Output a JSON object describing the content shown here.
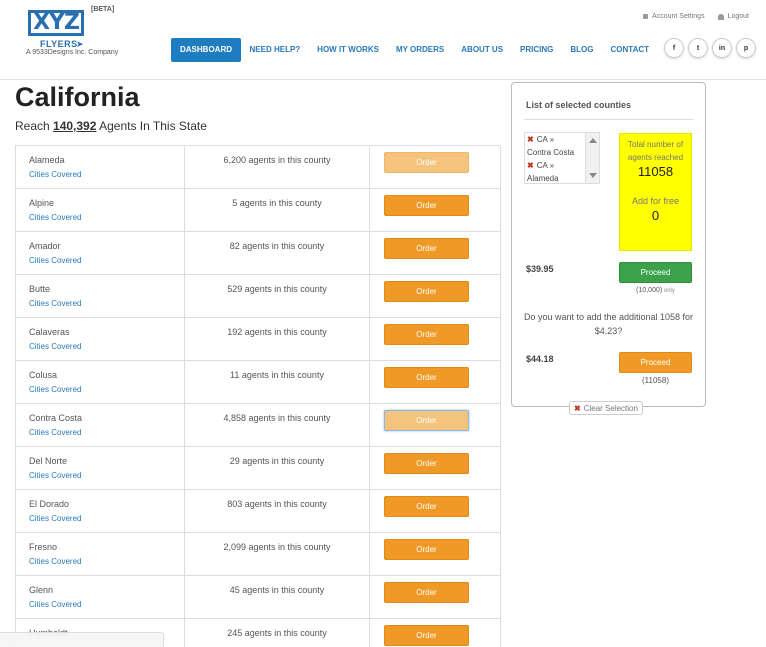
{
  "brand": {
    "logo_text": "XYZ",
    "beta": "[BETA]",
    "flyers": "FLYERS",
    "company": "A 9533Designs Inc. Company",
    "accent": "#2a6fb0"
  },
  "top_links": {
    "account": "Account Settings",
    "logout": "Logout"
  },
  "nav": [
    "DASHBOARD",
    "NEED HELP?",
    "HOW IT WORKS",
    "MY ORDERS",
    "ABOUT US",
    "PRICING",
    "BLOG",
    "CONTACT"
  ],
  "socials": [
    "f",
    "t",
    "in",
    "p"
  ],
  "page": {
    "title": "California",
    "reach_prefix": "Reach ",
    "reach_count": "140,392",
    "reach_suffix": " Agents In This State"
  },
  "counties": [
    {
      "name": "Alameda",
      "cities": "Cities Covered",
      "agents": "6,200 agents in this county",
      "order": "Order",
      "state": "faded"
    },
    {
      "name": "Alpine",
      "cities": "Cities Covered",
      "agents": "5 agents in this county",
      "order": "Order",
      "state": "normal"
    },
    {
      "name": "Amador",
      "cities": "Cities Covered",
      "agents": "82 agents in this county",
      "order": "Order",
      "state": "normal"
    },
    {
      "name": "Butte",
      "cities": "Cities Covered",
      "agents": "529 agents in this county",
      "order": "Order",
      "state": "normal"
    },
    {
      "name": "Calaveras",
      "cities": "Cities Covered",
      "agents": "192 agents in this county",
      "order": "Order",
      "state": "normal"
    },
    {
      "name": "Colusa",
      "cities": "Cities Covered",
      "agents": "11 agents in this county",
      "order": "Order",
      "state": "normal"
    },
    {
      "name": "Contra Costa",
      "cities": "Cities Covered",
      "agents": "4,858 agents in this county",
      "order": "Order",
      "state": "selected"
    },
    {
      "name": "Del Norte",
      "cities": "Cities Covered",
      "agents": "29 agents in this county",
      "order": "Order",
      "state": "normal"
    },
    {
      "name": "El Dorado",
      "cities": "Cities Covered",
      "agents": "803 agents in this county",
      "order": "Order",
      "state": "normal"
    },
    {
      "name": "Fresno",
      "cities": "Cities Covered",
      "agents": "2,099 agents in this county",
      "order": "Order",
      "state": "normal"
    },
    {
      "name": "Glenn",
      "cities": "Cities Covered",
      "agents": "45 agents in this county",
      "order": "Order",
      "state": "normal"
    },
    {
      "name": "Humboldt",
      "cities": "",
      "agents": "245 agents in this county",
      "order": "Order",
      "state": "normal"
    }
  ],
  "panel": {
    "title": "List of selected counties",
    "selected": [
      {
        "line1": "CA »",
        "line2": "Contra Costa"
      },
      {
        "line1": "CA »",
        "line2": "Alameda"
      }
    ],
    "total_label": "Total number of agents reached",
    "total_value": "11058",
    "free_label": "Add for free",
    "free_value": "0",
    "price1": "$39.95",
    "proceed1": "Proceed",
    "note1_main": "(10,000)",
    "note1_small": " only",
    "question": "Do you want to add the additional 1058 for $4.23?",
    "price2": "$44.18",
    "proceed2": "Proceed",
    "note2": "(11058)",
    "clear": "Clear Selection"
  }
}
